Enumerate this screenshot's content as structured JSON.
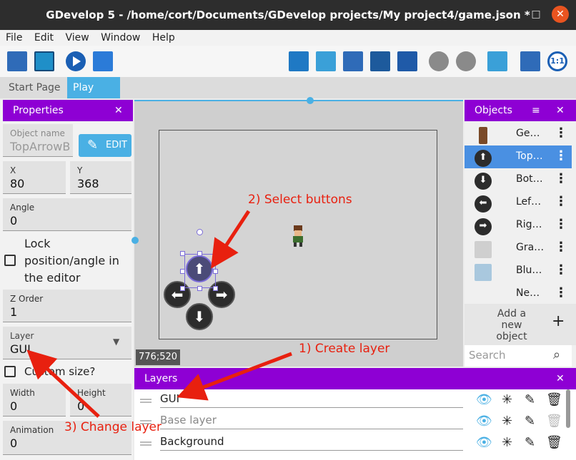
{
  "window": {
    "title": "GDevelop 5 - /home/cort/Documents/GDevelop projects/My project4/game.json *",
    "minimize": "–",
    "maximize": "□",
    "close": "✕"
  },
  "menu": [
    "File",
    "Edit",
    "View",
    "Window",
    "Help"
  ],
  "tabs": {
    "start": "Start Page",
    "play": "Play",
    "close": "✕"
  },
  "properties": {
    "header": "Properties",
    "close": "✕",
    "object_name_label": "Object name",
    "object_name_value": "TopArrowB",
    "edit_label": "EDIT",
    "x_label": "X",
    "x_value": "80",
    "y_label": "Y",
    "y_value": "368",
    "angle_label": "Angle",
    "angle_value": "0",
    "lock_label_1": "Lock",
    "lock_label_2": "position/angle in",
    "lock_label_3": "the editor",
    "zorder_label": "Z Order",
    "zorder_value": "1",
    "layer_label": "Layer",
    "layer_value": "GUI",
    "custom_size_label": "Custom size?",
    "width_label": "Width",
    "width_value": "0",
    "height_label": "Height",
    "height_value": "0",
    "animation_label": "Animation",
    "animation_value": "0"
  },
  "scene": {
    "coords": "776;520"
  },
  "annotations": {
    "a1": "1) Create layer",
    "a2": "2) Select buttons",
    "a3": "3) Change layer"
  },
  "objects": {
    "header": "Objects",
    "close": "✕",
    "items": [
      {
        "name": "Ge…",
        "icon": "player-sprite-icon"
      },
      {
        "name": "Top…",
        "icon": "arrow-up-icon",
        "selected": true
      },
      {
        "name": "Bot…",
        "icon": "arrow-down-icon"
      },
      {
        "name": "Lef…",
        "icon": "arrow-left-icon"
      },
      {
        "name": "Rig…",
        "icon": "arrow-right-icon"
      },
      {
        "name": "Gra…",
        "icon": "gray-tile-icon"
      },
      {
        "name": "Blu…",
        "icon": "blue-tile-icon"
      },
      {
        "name": "Ne…",
        "icon": "none"
      }
    ],
    "add_line1": "Add a new",
    "add_line2": "object",
    "add_icon": "+",
    "search_placeholder": "Search"
  },
  "layers": {
    "header": "Layers",
    "close": "✕",
    "rows": [
      {
        "name": "GUI"
      },
      {
        "name": "Base layer"
      },
      {
        "name": "Background"
      }
    ]
  },
  "colors": {
    "accent": "#8e00d4",
    "tab": "#4ab0e4",
    "annotation": "#e8200f",
    "selected_row": "#4a90e2"
  }
}
